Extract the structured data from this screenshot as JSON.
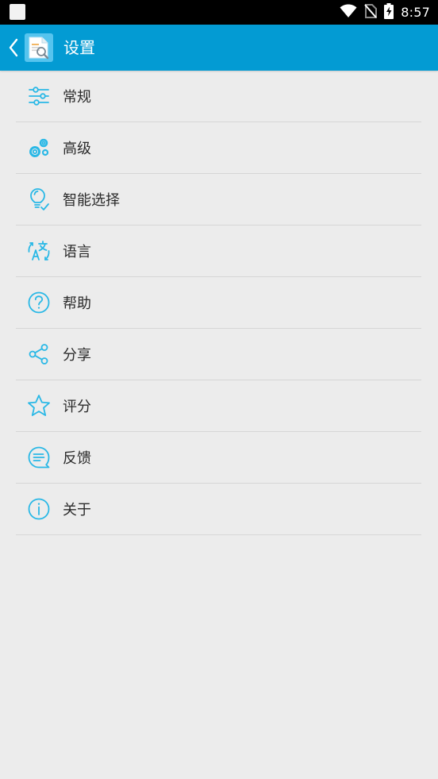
{
  "status_bar": {
    "time": "8:57"
  },
  "app_bar": {
    "title": "设置"
  },
  "colors": {
    "accent": "#039bd3",
    "icon": "#29b8e6"
  },
  "menu": [
    {
      "label": "常规",
      "icon": "sliders-icon"
    },
    {
      "label": "高级",
      "icon": "gears-icon"
    },
    {
      "label": "智能选择",
      "icon": "lightbulb-icon"
    },
    {
      "label": "语言",
      "icon": "translate-icon"
    },
    {
      "label": "帮助",
      "icon": "help-icon"
    },
    {
      "label": "分享",
      "icon": "share-icon"
    },
    {
      "label": "评分",
      "icon": "star-icon"
    },
    {
      "label": "反馈",
      "icon": "feedback-icon"
    },
    {
      "label": "关于",
      "icon": "info-icon"
    }
  ]
}
